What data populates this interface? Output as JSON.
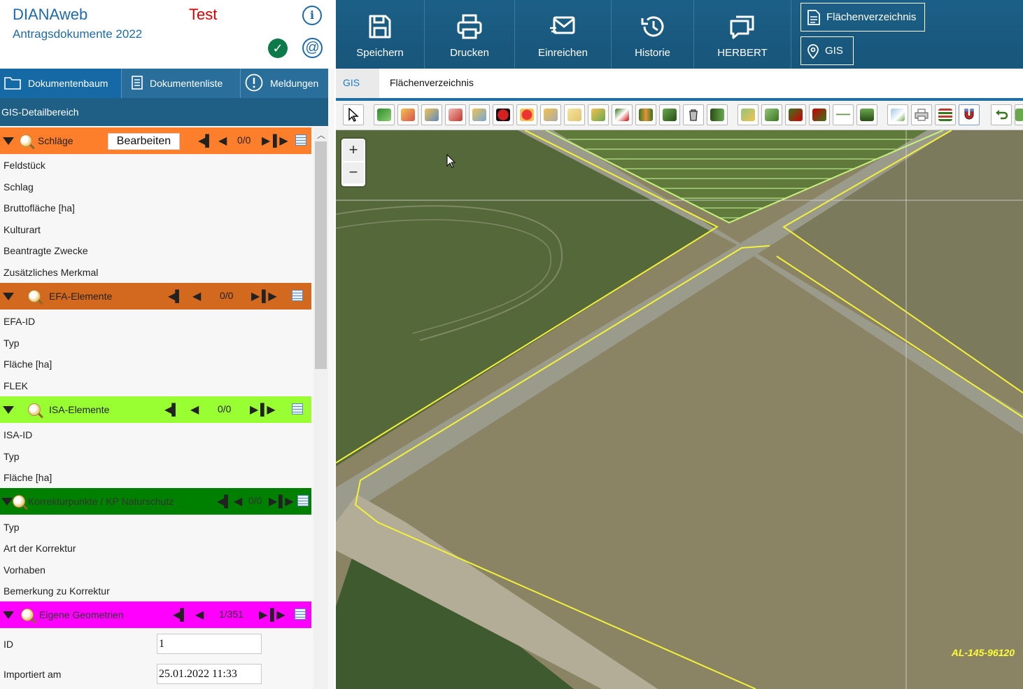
{
  "app": {
    "title": "DIANAweb",
    "subtitle": "Antragsdokumente 2022",
    "env": "Test"
  },
  "tabs": [
    {
      "label": "Dokumentenbaum"
    },
    {
      "label": "Dokumentenliste"
    },
    {
      "label": "Meldungen"
    }
  ],
  "panel_title": "GIS-Detailbereich",
  "sections": {
    "schlaege": {
      "name": "Schläge",
      "count": "0/0",
      "edit_label": "Bearbeiten",
      "color": "#fd7f2b",
      "fields": [
        "Feldstück",
        "Schlag",
        "Bruttofläche [ha]",
        "Kulturart",
        "Beantragte Zwecke",
        "Zusätzliches Merkmal"
      ]
    },
    "efa": {
      "name": "EFA-Elemente",
      "count": "0/0",
      "color": "#d2691e",
      "fields": [
        "EFA-ID",
        "Typ",
        "Fläche [ha]",
        "FLEK"
      ]
    },
    "isa": {
      "name": "ISA-Elemente",
      "count": "0/0",
      "color": "#99ff33",
      "fields": [
        "ISA-ID",
        "Typ",
        "Fläche [ha]"
      ]
    },
    "korrektur": {
      "name": "Korrekturpunkte / KP Naturschutz",
      "count": "0/0",
      "color": "#008000",
      "fields": [
        "Typ",
        "Art der Korrektur",
        "Vorhaben",
        "Bemerkung zu Korrektur"
      ]
    },
    "eigene": {
      "name": "Eigene Geometrien",
      "count": "1/351",
      "color": "#ff00ff",
      "fields": [
        {
          "label": "ID",
          "value": "1"
        },
        {
          "label": "Importiert am",
          "value": "25.01.2022 11:33"
        }
      ]
    }
  },
  "toolbar": {
    "buttons": [
      {
        "label": "Speichern",
        "icon": "save-icon"
      },
      {
        "label": "Drucken",
        "icon": "printer-icon"
      },
      {
        "label": "Einreichen",
        "icon": "send-mail-icon"
      },
      {
        "label": "Historie",
        "icon": "history-icon"
      },
      {
        "label": "HERBERT",
        "icon": "chat-icon"
      }
    ],
    "nav": [
      {
        "label": "Flächenverzeichnis",
        "icon": "document-icon"
      },
      {
        "label": "GIS",
        "icon": "map-pin-icon"
      }
    ]
  },
  "subtabs": {
    "gis": "GIS",
    "fv": "Flächenverzeichnis"
  },
  "map": {
    "zoom_in": "+",
    "zoom_out": "−",
    "parcel_label": "AL-145-96120",
    "boundary_color": "#f2f23a"
  }
}
